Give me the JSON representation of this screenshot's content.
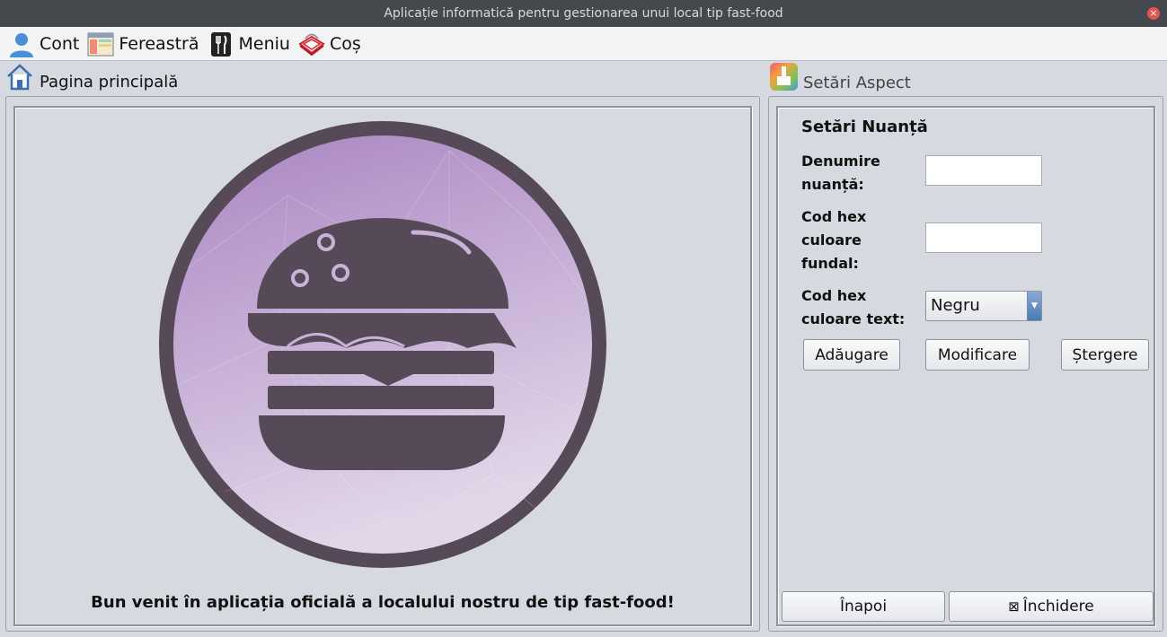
{
  "window": {
    "title": "Aplicație informatică pentru gestionarea unui local tip fast-food",
    "close_glyph": "×"
  },
  "menubar": {
    "items": [
      {
        "label": "Cont",
        "icon": "user-icon"
      },
      {
        "label": "Fereastră",
        "icon": "window-icon"
      },
      {
        "label": "Meniu",
        "icon": "cutlery-icon"
      },
      {
        "label": "Coș",
        "icon": "basket-icon"
      }
    ]
  },
  "main": {
    "tab_label": "Pagina principală",
    "tab_icon": "home-icon",
    "welcome_text": "Bun venit în aplicația oficială a localului nostru de tip fast-food!",
    "logo": {
      "icon": "burger-logo",
      "colors": {
        "ring": "#564a58",
        "bg_light": "#e2d6e8",
        "bg_dark": "#a985c2"
      }
    }
  },
  "settings": {
    "tab_label": "Setări Aspect",
    "tab_icon": "paint-brush-icon",
    "section_title": "Setări Nuanță",
    "fields": {
      "shade_name": {
        "label_line1": "Denumire",
        "label_line2": "nuanță:",
        "value": ""
      },
      "bg_hex": {
        "label_line1": "Cod hex",
        "label_line2": "culoare",
        "label_line3": "fundal:",
        "value": ""
      },
      "text_hex": {
        "label_line1": "Cod hex",
        "label_line2": "culoare text:",
        "selected": "Negru"
      }
    },
    "buttons": {
      "add": "Adăugare",
      "modify": "Modificare",
      "delete": "Ștergere"
    },
    "footer": {
      "back": "Înapoi",
      "close": "Închidere",
      "close_glyph": "⊠"
    }
  }
}
